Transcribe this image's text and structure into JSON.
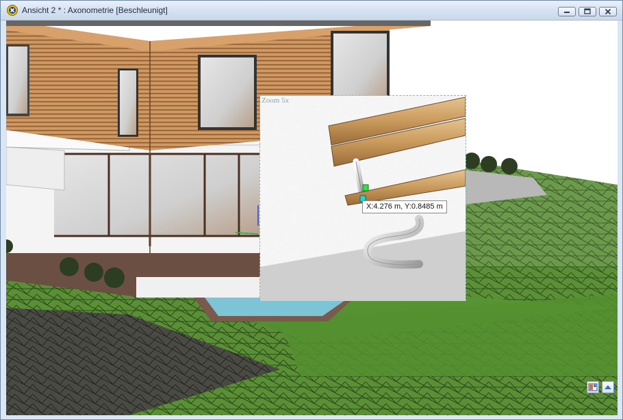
{
  "window": {
    "title": "Ansicht 2 * : Axonometrie [Beschleunigt]",
    "app_icon": "close-x-circle-icon",
    "controls": [
      "minimize-icon",
      "maximize-icon",
      "close-icon"
    ]
  },
  "viewport": {
    "zoom_label": "Zoom 5x",
    "cursor_readout": "X:4.276 m, Y:0.8485 m"
  },
  "corner_buttons": [
    "view-layout-icon",
    "scroll-up-arrow-icon"
  ],
  "colors": {
    "wood_facade": "#c9915a",
    "lawn": "#4f8a2e",
    "pool_water": "#7cc4d6",
    "terrace_deck": "#6b4f43",
    "plaster_wall": "#efefef"
  }
}
